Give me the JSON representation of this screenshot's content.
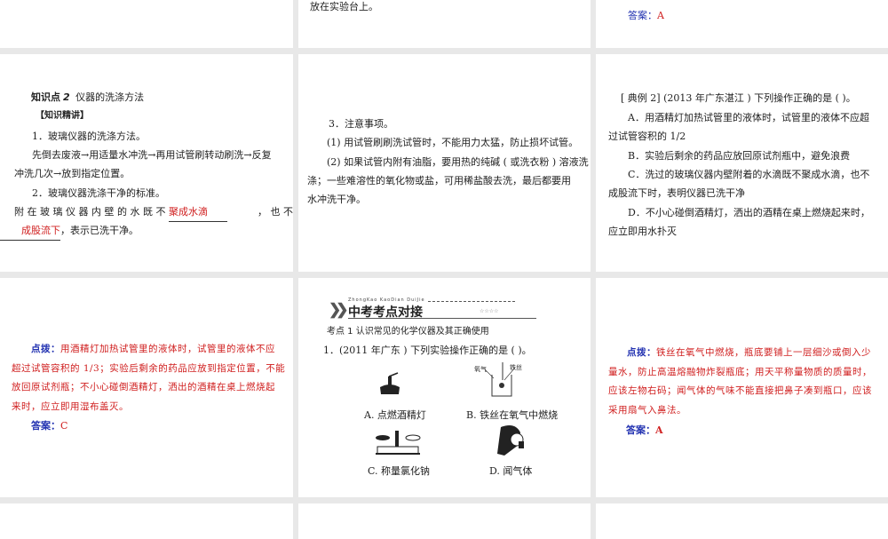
{
  "slides": {
    "top_mid": {
      "text": "放在实验台上。"
    },
    "top_right": {
      "answer_label": "答案：",
      "answer_value": "A"
    },
    "s1": {
      "heading_prefix": "知识点",
      "heading_num": "2",
      "heading": "仪器的洗涤方法",
      "section": "【知识精讲】",
      "p1": "1．玻璃仪器的洗涤方法。",
      "p2a": "先倒去废液→用适量水冲洗→再用试管刷转动刷洗→反复",
      "p2b": "冲洗几次→放到指定位置。",
      "p3": "2．玻璃仪器洗涤干净的标准。",
      "p4a": "附 在 玻 璃 仪 器 内 壁 的 水 既 不",
      "blank1": "聚成水滴",
      "p4b": "，  也 不",
      "blank2": "成股流下",
      "p4c": "，表示已洗干净。"
    },
    "s2": {
      "p1": "3．注意事项。",
      "p2": "(1) 用试管刷刷洗试管时，不能用力太猛，防止损坏试管。",
      "p3a": "(2) 如果试管内附有油脂，要用热的纯碱 ( 或洗衣粉 ) 溶液洗",
      "p3b": "涤；一些难溶性的氧化物或盐，可用稀盐酸去洗，最后都要用",
      "p3c": "水冲洗干净。"
    },
    "s3": {
      "q": "[ 典例  2] (2013  年广东湛江 ) 下列操作正确的是 (    )。",
      "a1": "A．用酒精灯加热试管里的液体时，试管里的液体不应超",
      "a2": "过试管容积的   1/2",
      "b": "B．实验后剩余的药品应放回原试剂瓶中，避免浪费",
      "c1": "C．洗过的玻璃仪器内壁附着的水滴既不聚成水滴，也不",
      "c2": "成股流下时，表明仪器已洗干净",
      "d1": "D．不小心碰倒酒精灯，洒出的酒精在桌上燃烧起来时，",
      "d2": "应立即用水扑灭"
    },
    "s4": {
      "hint_label": "点拨：",
      "h1": "用酒精灯加热试管里的液体时，试管里的液体不应",
      "h2": "超过试管容积的  1/3；实验后剩余的药品应放到指定位置，不能",
      "h3": "放回原试剂瓶；不小心碰倒酒精灯，洒出的酒精在桌上燃烧起",
      "h4": "来时，应立即用湿布盖灭。",
      "answer_label": "答案：",
      "answer_value": "C"
    },
    "s5": {
      "banner_pinyin": "ZhongKao KaoDian DuiJie",
      "banner_title": "中考考点对接",
      "stars": "☆☆☆☆",
      "topic": "考点  1   认识常见的化学仪器及其正确使用",
      "q": "1．(2011  年广东 ) 下列实验操作正确的是 (    )。",
      "fig_b_label1": "氧气",
      "fig_b_label2": "铁丝",
      "opt_a": "A. 点燃酒精灯",
      "opt_b": "B. 铁丝在氧气中燃烧",
      "opt_c": "C. 称量氯化钠",
      "opt_d": "D. 闻气体"
    },
    "s6": {
      "hint_label": "点拨：",
      "h1": "铁丝在氧气中燃烧，瓶底要铺上一层细沙或倒入少",
      "h2": "量水，防止高温熔融物炸裂瓶底；用天平称量物质的质量时，",
      "h3": "应该左物右码；闻气体的气味不能直接把鼻子凑到瓶口，应该",
      "h4": "采用扇气入鼻法。",
      "answer_label": "答案：",
      "answer_value": "A"
    }
  }
}
